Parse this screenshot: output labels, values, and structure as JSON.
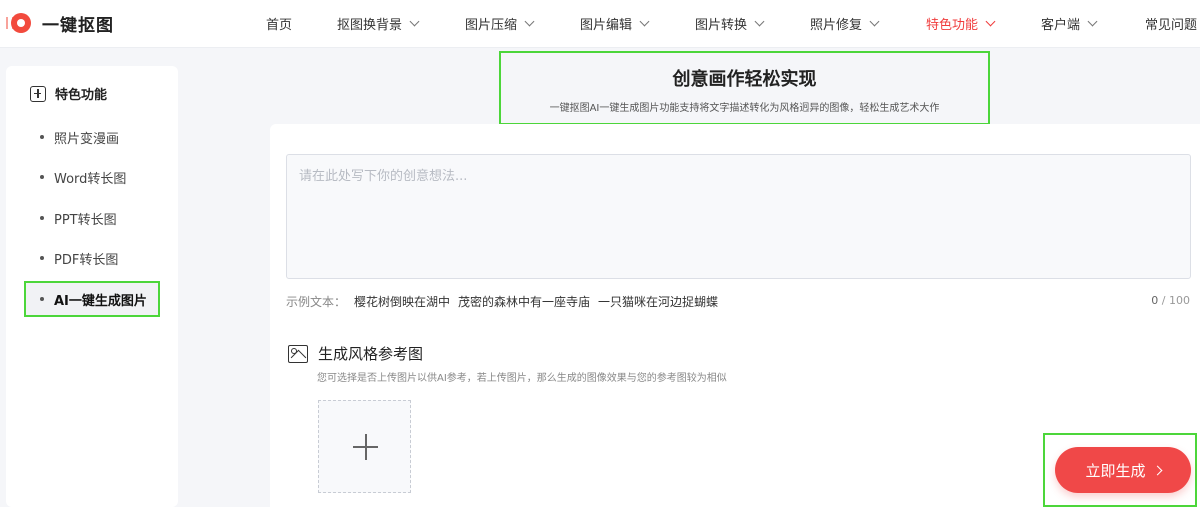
{
  "brand": {
    "name": "一键抠图"
  },
  "nav": [
    {
      "label": "首页",
      "dropdown": false
    },
    {
      "label": "抠图换背景",
      "dropdown": true
    },
    {
      "label": "图片压缩",
      "dropdown": true
    },
    {
      "label": "图片编辑",
      "dropdown": true
    },
    {
      "label": "图片转换",
      "dropdown": true
    },
    {
      "label": "照片修复",
      "dropdown": true
    },
    {
      "label": "特色功能",
      "dropdown": true,
      "active": true
    },
    {
      "label": "客户端",
      "dropdown": true
    },
    {
      "label": "常见问题",
      "dropdown": false
    }
  ],
  "sidebar": {
    "title": "特色功能",
    "items": [
      {
        "label": "照片变漫画"
      },
      {
        "label": "Word转长图"
      },
      {
        "label": "PPT转长图"
      },
      {
        "label": "PDF转长图"
      },
      {
        "label": "AI一键生成图片",
        "active": true
      }
    ]
  },
  "hero": {
    "title": "创意画作轻松实现",
    "subtitle": "一键抠图AI一键生成图片功能支持将文字描述转化为风格迥异的图像，轻松生成艺术大作"
  },
  "prompt": {
    "placeholder": "请在此处写下你的创意想法...",
    "value": "",
    "examples_label": "示例文本：",
    "examples": [
      "樱花树倒映在湖中",
      "茂密的森林中有一座寺庙",
      "一只猫咪在河边捉蝴蝶"
    ],
    "count": "0",
    "max": "/ 100"
  },
  "style_ref": {
    "title": "生成风格参考图",
    "description": "您可选择是否上传图片以供AI参考，若上传图片，那么生成的图像效果与您的参考图较为相似"
  },
  "generate": {
    "label": "立即生成"
  },
  "colors": {
    "accent": "#f04848",
    "highlight": "#4cd63a"
  },
  "icons": {
    "logo": "logo-icon",
    "feature": "feature-box-icon",
    "image": "image-icon",
    "upload": "plus-icon"
  }
}
